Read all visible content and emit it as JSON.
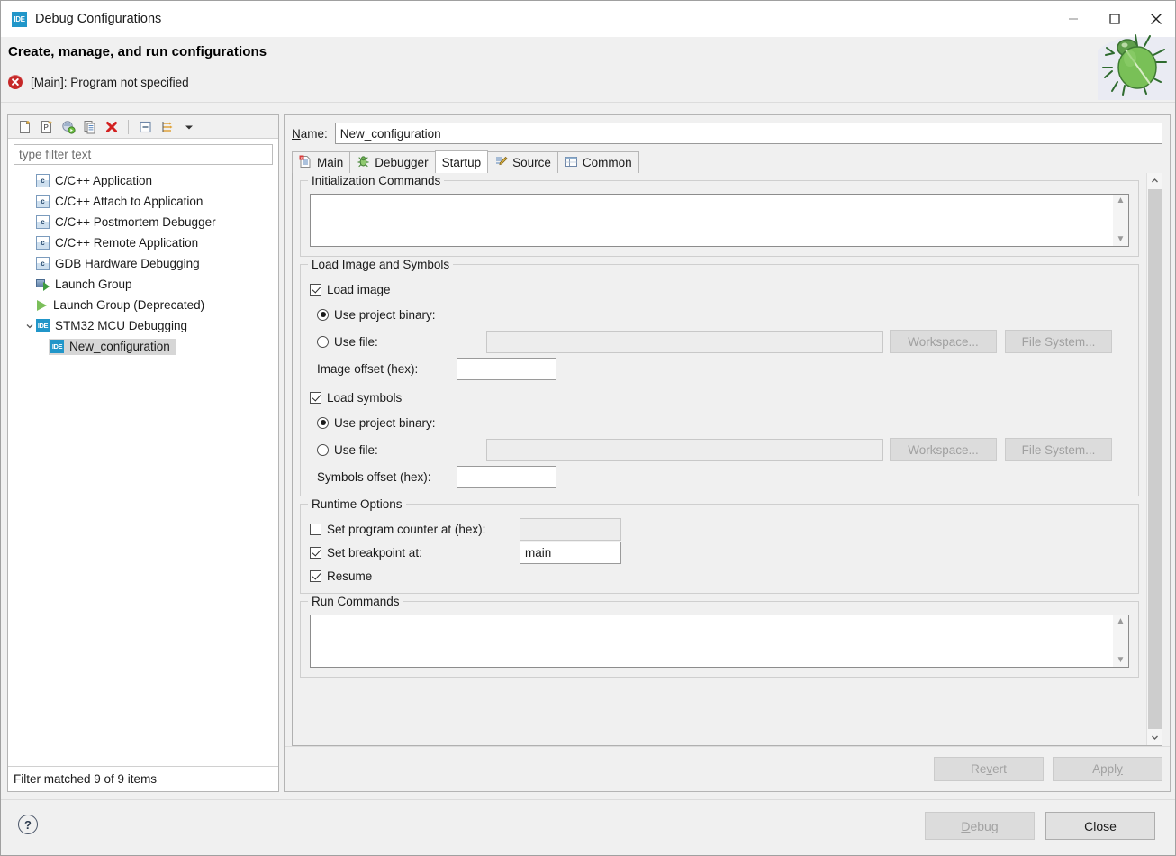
{
  "window": {
    "title": "Debug Configurations",
    "title_icon": "ide-icon",
    "minimize": "minimize-icon",
    "maximize": "maximize-icon",
    "close": "close-icon"
  },
  "header": {
    "title": "Create, manage, and run configurations",
    "status_icon": "error-icon",
    "status_text": "[Main]: Program not specified"
  },
  "left_panel": {
    "toolbar": [
      {
        "name": "new-launch-configuration-icon",
        "tooltip": "New launch configuration"
      },
      {
        "name": "new-prototype-icon",
        "tooltip": "New prototype"
      },
      {
        "name": "export-icon",
        "tooltip": "Export"
      },
      {
        "name": "duplicate-icon",
        "tooltip": "Duplicate"
      },
      {
        "name": "delete-icon",
        "tooltip": "Delete"
      },
      {
        "name": "collapse-all-icon",
        "tooltip": "Collapse All"
      },
      {
        "name": "filter-icon",
        "tooltip": "Filter launch configurations"
      },
      {
        "name": "chevron-down-icon",
        "tooltip": "View Menu"
      }
    ],
    "filter_placeholder": "type filter text",
    "filter_value": "",
    "tree": [
      {
        "label": "C/C++ Application",
        "icon": "c-icon",
        "indent": 0,
        "expandable": false,
        "selected": false
      },
      {
        "label": "C/C++ Attach to Application",
        "icon": "c-icon",
        "indent": 0,
        "expandable": false,
        "selected": false
      },
      {
        "label": "C/C++ Postmortem Debugger",
        "icon": "c-icon",
        "indent": 0,
        "expandable": false,
        "selected": false
      },
      {
        "label": "C/C++ Remote Application",
        "icon": "c-icon",
        "indent": 0,
        "expandable": false,
        "selected": false
      },
      {
        "label": "GDB Hardware Debugging",
        "icon": "c-icon",
        "indent": 0,
        "expandable": false,
        "selected": false
      },
      {
        "label": "Launch Group",
        "icon": "launch-group-icon",
        "indent": 0,
        "expandable": false,
        "selected": false
      },
      {
        "label": "Launch Group (Deprecated)",
        "icon": "play-icon",
        "indent": 0,
        "expandable": false,
        "selected": false
      },
      {
        "label": "STM32 MCU Debugging",
        "icon": "ide-icon",
        "indent": 0,
        "expandable": true,
        "expanded": true,
        "selected": false
      },
      {
        "label": "New_configuration",
        "icon": "ide-icon",
        "indent": 1,
        "expandable": false,
        "selected": true
      }
    ],
    "status": "Filter matched 9 of 9 items"
  },
  "right_panel": {
    "name_label": "Name:",
    "name_label_mnemonic": "N",
    "name_value": "New_configuration",
    "tabs": [
      {
        "label": "Main",
        "icon": "main-tab-icon",
        "active": false,
        "mnemonic": ""
      },
      {
        "label": "Debugger",
        "icon": "debugger-tab-icon",
        "active": false,
        "mnemonic": ""
      },
      {
        "label": "Startup",
        "icon": "",
        "active": true,
        "mnemonic": ""
      },
      {
        "label": "Source",
        "icon": "source-tab-icon",
        "active": false,
        "mnemonic": ""
      },
      {
        "label": "Common",
        "icon": "common-tab-icon",
        "active": false,
        "mnemonic": "C"
      }
    ],
    "groups": {
      "init_commands": {
        "legend": "Initialization Commands",
        "value": ""
      },
      "load_image": {
        "legend": "Load Image and Symbols",
        "load_image": {
          "label": "Load image",
          "checked": true
        },
        "image_project_binary": {
          "label": "Use project binary:",
          "checked": true
        },
        "image_use_file": {
          "label": "Use file:",
          "checked": false,
          "value": ""
        },
        "image_workspace_button": "Workspace...",
        "image_filesystem_button": "File System...",
        "image_offset_label": "Image offset (hex):",
        "image_offset_value": "",
        "load_symbols": {
          "label": "Load symbols",
          "checked": true
        },
        "symbols_project_binary": {
          "label": "Use project binary:",
          "checked": true
        },
        "symbols_use_file": {
          "label": "Use file:",
          "checked": false,
          "value": ""
        },
        "symbols_workspace_button": "Workspace...",
        "symbols_filesystem_button": "File System...",
        "symbols_offset_label": "Symbols offset (hex):",
        "symbols_offset_value": ""
      },
      "runtime_options": {
        "legend": "Runtime Options",
        "set_pc": {
          "label": "Set program counter at (hex):",
          "checked": false,
          "value": ""
        },
        "set_breakpoint": {
          "label": "Set breakpoint at:",
          "checked": true,
          "value": "main"
        },
        "resume": {
          "label": "Resume",
          "checked": true
        }
      },
      "run_commands": {
        "legend": "Run Commands",
        "value": ""
      }
    },
    "revert_button": "Revert",
    "revert_mnemonic": "v",
    "apply_button": "Apply",
    "apply_mnemonic": "y"
  },
  "footer": {
    "help": "?",
    "debug_button": "Debug",
    "debug_mnemonic": "D",
    "close_button": "Close"
  },
  "colors": {
    "accent_blue": "#2196c9",
    "error_red": "#c62828",
    "selection_gray": "#d6d6d6",
    "window_bg": "#f0f0f0"
  }
}
